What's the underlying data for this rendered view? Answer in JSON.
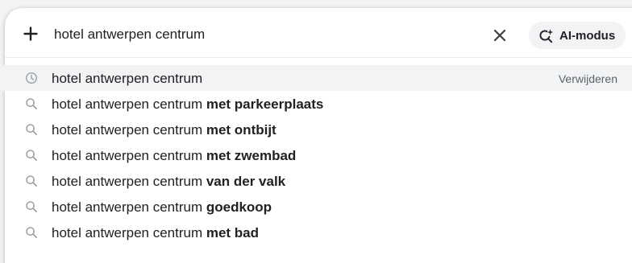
{
  "search": {
    "query": "hotel antwerpen centrum",
    "ai_mode_label": "AI-modus"
  },
  "suggestions": [
    {
      "prefix": "hotel antwerpen centrum",
      "bold": "",
      "icon": "history-icon",
      "remove_label": "Verwijderen"
    },
    {
      "prefix": "hotel antwerpen centrum ",
      "bold": "met parkeerplaats",
      "icon": "search-icon"
    },
    {
      "prefix": "hotel antwerpen centrum ",
      "bold": "met ontbijt",
      "icon": "search-icon"
    },
    {
      "prefix": "hotel antwerpen centrum ",
      "bold": "met zwembad",
      "icon": "search-icon"
    },
    {
      "prefix": "hotel antwerpen centrum ",
      "bold": "van der valk",
      "icon": "search-icon"
    },
    {
      "prefix": "hotel antwerpen centrum ",
      "bold": "goedkoop",
      "icon": "search-icon"
    },
    {
      "prefix": "hotel antwerpen centrum ",
      "bold": "met bad",
      "icon": "search-icon"
    }
  ],
  "colors": {
    "text": "#202124",
    "muted": "#5f6368",
    "hover_bg": "#f1f3f4"
  }
}
